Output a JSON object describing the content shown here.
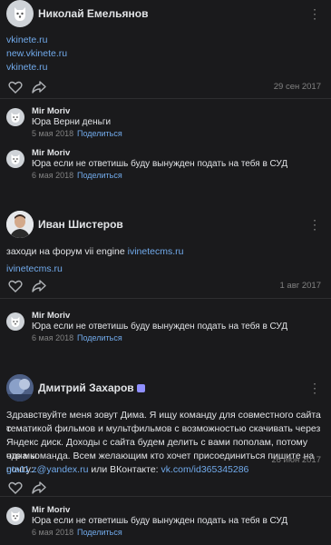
{
  "posts": [
    {
      "author": "Николай Емельянов",
      "lines": [
        "vkinete.ru",
        "new.vkinete.ru",
        "vkinete.ru"
      ],
      "date": "29 сен 2017",
      "comments": [
        {
          "author": "Mir Moriv",
          "text": "Юра Верни деньги",
          "date": "5 мая 2018",
          "reply": "Поделиться"
        },
        {
          "author": "Mir Moriv",
          "text": "Юра если не ответишь буду вынужден подать на тебя в СУД",
          "date": "6 мая 2018",
          "reply": "Поделиться"
        }
      ]
    },
    {
      "author": "Иван Шистеров",
      "text_plain": "заходи на форум vii engine ",
      "text_link": "ivinetecms.ru",
      "link_line": "ivinetecms.ru",
      "date": "1 авг 2017",
      "comments": [
        {
          "author": "Mir Moriv",
          "text": "Юра если не ответишь буду вынужден подать на тебя в СУД",
          "date": "6 мая 2018",
          "reply": "Поделиться"
        }
      ]
    },
    {
      "author": "Дмитрий Захаров",
      "body_lines": [
        "Здравствуйте меня зовут Дима. Я ищу команду для совместного сайта с",
        "тематикой фильмов и мультфильмов с возможностью скачивать через",
        "Яндекс диск. Доходы с сайта будем делить с вами пополам, потому что мы",
        "одна команда. Всем желающим кто хочет присоединиться пишите на почту:"
      ],
      "email": "gta11.z@yandex.ru",
      "mid": " или ВКонтакте: ",
      "vk": "vk.com/id365345286",
      "date": "26 июн 2017",
      "comments": [
        {
          "author": "Mir Moriv",
          "text": "Юра если не ответишь буду вынужден подать на тебя в СУД",
          "date": "6 мая 2018",
          "reply": "Поделиться"
        }
      ]
    }
  ],
  "icons": {
    "like": "heart-icon",
    "share": "share-icon",
    "more": "more-options-icon"
  },
  "colors": {
    "background": "#1a1a1c",
    "link": "#71aaeb",
    "muted": "#828282",
    "text": "#e1e3e6"
  }
}
